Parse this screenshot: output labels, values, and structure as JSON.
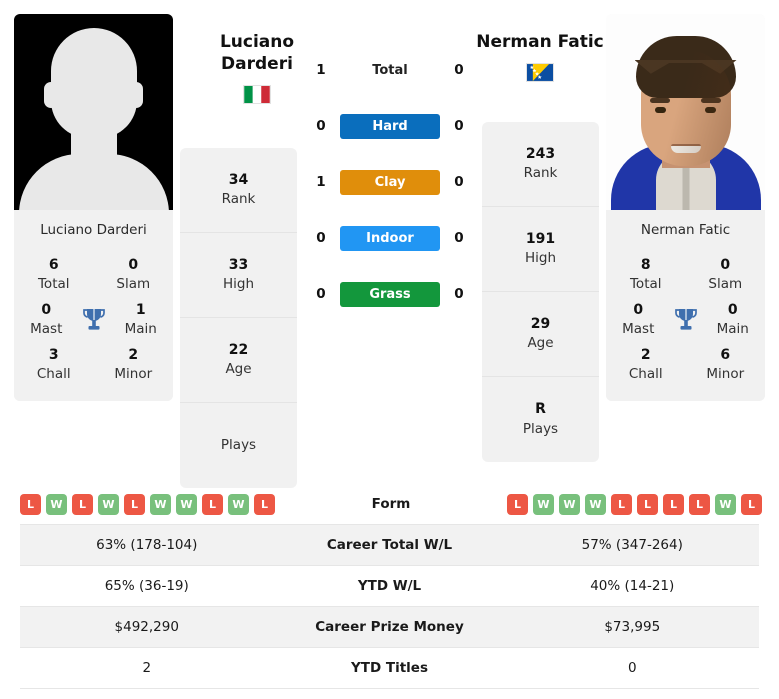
{
  "players": {
    "left": {
      "name_line1": "Luciano",
      "name_line2": "Darderi",
      "full_name": "Luciano Darderi",
      "country": "Italy",
      "flag": "it-flag-icon",
      "photo": "player-photo-placeholder",
      "titles": [
        {
          "value": "6",
          "label": "Total"
        },
        {
          "value": "0",
          "label": "Slam"
        },
        {
          "value": "0",
          "label": "Mast"
        },
        {
          "value": "1",
          "label": "Main"
        },
        {
          "value": "3",
          "label": "Chall"
        },
        {
          "value": "2",
          "label": "Minor"
        }
      ],
      "profile": [
        {
          "value": "34",
          "label": "Rank"
        },
        {
          "value": "33",
          "label": "High"
        },
        {
          "value": "22",
          "label": "Age"
        },
        {
          "value": "",
          "label": "Plays"
        }
      ],
      "form": [
        "L",
        "W",
        "L",
        "W",
        "L",
        "W",
        "W",
        "L",
        "W",
        "L"
      ]
    },
    "right": {
      "name_line1": "Nerman Fatic",
      "name_line2": "",
      "full_name": "Nerman Fatic",
      "country": "Bosnia and Herzegovina",
      "flag": "ba-flag-icon",
      "photo": "player-photo",
      "titles": [
        {
          "value": "8",
          "label": "Total"
        },
        {
          "value": "0",
          "label": "Slam"
        },
        {
          "value": "0",
          "label": "Mast"
        },
        {
          "value": "0",
          "label": "Main"
        },
        {
          "value": "2",
          "label": "Chall"
        },
        {
          "value": "6",
          "label": "Minor"
        }
      ],
      "profile": [
        {
          "value": "243",
          "label": "Rank"
        },
        {
          "value": "191",
          "label": "High"
        },
        {
          "value": "29",
          "label": "Age"
        },
        {
          "value": "R",
          "label": "Plays"
        }
      ],
      "form": [
        "L",
        "W",
        "W",
        "W",
        "L",
        "L",
        "L",
        "L",
        "W",
        "L"
      ]
    }
  },
  "head_to_head": [
    {
      "label": "Total",
      "left": "1",
      "right": "0",
      "style": "plain",
      "color": ""
    },
    {
      "label": "Hard",
      "left": "0",
      "right": "0",
      "style": "badge",
      "color": "#0a6ebd"
    },
    {
      "label": "Clay",
      "left": "1",
      "right": "0",
      "style": "badge",
      "color": "#e08e0b"
    },
    {
      "label": "Indoor",
      "left": "0",
      "right": "0",
      "style": "badge",
      "color": "#2196f3"
    },
    {
      "label": "Grass",
      "left": "0",
      "right": "0",
      "style": "badge",
      "color": "#13973c"
    }
  ],
  "comparison_table": [
    {
      "label": "Form",
      "left": "",
      "right": "",
      "type": "form",
      "shaded": false
    },
    {
      "label": "Career Total W/L",
      "left": "63% (178-104)",
      "right": "57% (347-264)",
      "type": "text",
      "shaded": true
    },
    {
      "label": "YTD W/L",
      "left": "65% (36-19)",
      "right": "40% (14-21)",
      "type": "text",
      "shaded": false
    },
    {
      "label": "Career Prize Money",
      "left": "$492,290",
      "right": "$73,995",
      "type": "text",
      "shaded": true
    },
    {
      "label": "YTD Titles",
      "left": "2",
      "right": "0",
      "type": "text",
      "shaded": false
    }
  ],
  "colors": {
    "win_badge": "#78c07c",
    "loss_badge": "#ed5744",
    "trophy": "#3f6fae",
    "card_bg": "#f1f1f1",
    "row_shaded": "#f2f2f2"
  },
  "icons": {
    "trophy": "trophy-icon"
  }
}
